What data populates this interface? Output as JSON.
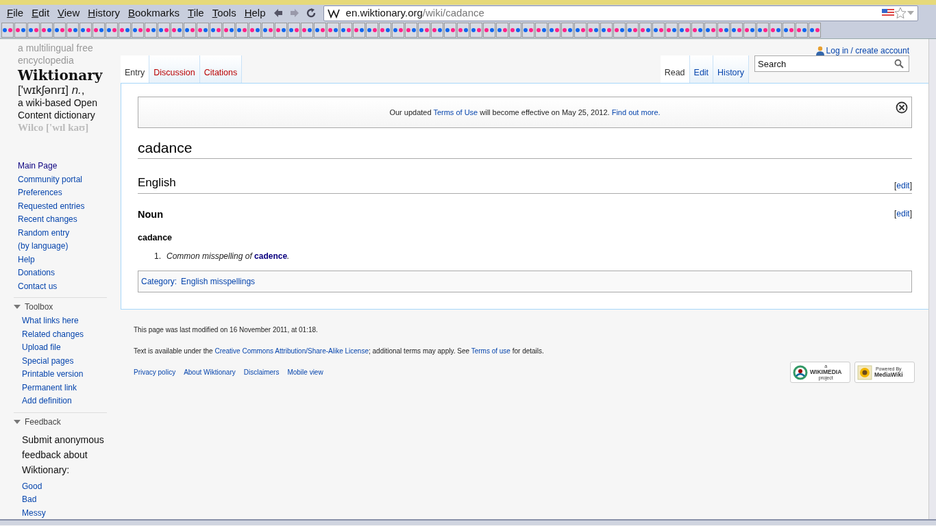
{
  "browser": {
    "menu": [
      "File",
      "Edit",
      "View",
      "History",
      "Bookmarks",
      "Tile",
      "Tools",
      "Help"
    ],
    "address": {
      "domain": "en.wiktionary.org",
      "path": "/wiki/cadance"
    }
  },
  "sidebar": {
    "logo_lines": [
      "a multilingual free",
      "encyclopedia",
      "Wiktionary",
      "['wɪkʃənrɪ] *n.*,",
      "a wiki-based Open",
      "Content dictionary",
      "Wilco ['wɪl kaʊ]"
    ],
    "navigation": [
      "Main Page",
      "Community portal",
      "Preferences",
      "Requested entries",
      "Recent changes",
      "Random entry",
      "(by language)",
      "Help",
      "Donations",
      "Contact us"
    ],
    "portals": [
      {
        "title": "Toolbox",
        "expanded": true,
        "items": [
          "What links here",
          "Related changes",
          "Upload file",
          "Special pages",
          "Printable version",
          "Permanent link",
          "Add definition"
        ]
      },
      {
        "title": "Feedback",
        "expanded": true,
        "text": "Submit anonymous feedback about Wiktionary:",
        "items": [
          "Good",
          "Bad",
          "Messy"
        ]
      }
    ]
  },
  "personal": {
    "login": "Log in / create account"
  },
  "tabs_left": [
    {
      "label": "Entry",
      "selected": true,
      "exists": true
    },
    {
      "label": "Discussion",
      "selected": false,
      "exists": false
    },
    {
      "label": "Citations",
      "selected": false,
      "exists": false
    }
  ],
  "tabs_right": [
    {
      "label": "Read",
      "selected": true
    },
    {
      "label": "Edit",
      "selected": false
    },
    {
      "label": "History",
      "selected": false
    }
  ],
  "search": {
    "placeholder": "Search"
  },
  "notice": [
    {
      "text": "Our updated ",
      "link": false
    },
    {
      "text": "Terms of Use",
      "link": true
    },
    {
      "text": " will become effective on May 25, 2012. ",
      "link": false
    },
    {
      "text": "Find out more.",
      "link": true
    }
  ],
  "page_title": "cadance",
  "sections": [
    {
      "heading": "English",
      "kind": "language",
      "edit": {
        "open": "[",
        "text": "edit",
        "close": "]"
      }
    },
    {
      "heading": "Noun",
      "kind": "part_of_speech",
      "edit": {
        "open": "[",
        "text": "edit",
        "close": "]"
      }
    }
  ],
  "headword": "cadance",
  "definitions": [
    {
      "number": "1.",
      "parts": [
        {
          "text": "Common misspelling of ",
          "link": false
        },
        {
          "text": "cadence",
          "link": true
        },
        {
          "text": ".",
          "link": false
        }
      ]
    }
  ],
  "categories": {
    "label": "Category:",
    "items": [
      "English misspellings"
    ]
  },
  "footer": {
    "last_modified": "This page was last modified on 16 November 2011, at 01:18.",
    "license": [
      {
        "text": "Text is available under the ",
        "link": false
      },
      {
        "text": "Creative Commons Attribution/Share-Alike License",
        "link": true
      },
      {
        "text": "; additional terms may apply. See ",
        "link": false
      },
      {
        "text": "Terms of use",
        "link": true
      },
      {
        "text": " for details.",
        "link": false
      }
    ],
    "links": [
      "Privacy policy",
      "About Wiktionary",
      "Disclaimers",
      "Mobile view"
    ],
    "badges": [
      {
        "kind": "wikimedia",
        "top": "a",
        "main": "WIKIMEDIA",
        "sub": "project"
      },
      {
        "kind": "mediawiki",
        "top": "Powered By",
        "main": "MediaWiki"
      }
    ]
  }
}
